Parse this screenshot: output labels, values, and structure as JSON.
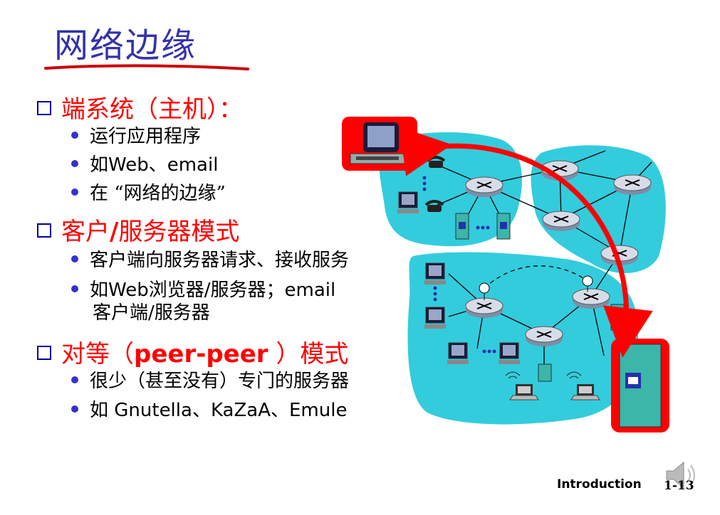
{
  "slide": {
    "title": "网络边缘",
    "sections": [
      {
        "heading_pre": "端系统（主机）：",
        "bullets": [
          {
            "pre": "运行应用程序"
          },
          {
            "pre": "如",
            "latin": "Web",
            "post": "、",
            "latin2": "email"
          },
          {
            "pre": "在 “网络的边缘”"
          }
        ]
      },
      {
        "heading_pre": "客户",
        "heading_latin": "/",
        "heading_post": "服务器模式",
        "bullets": [
          {
            "pre": "客户端向服务器请求、接收服务"
          },
          {
            "pre": "如",
            "latin": "Web",
            "post": "浏览器",
            "latin2": "/",
            "post2": "服务器；",
            "latin3": "email",
            "cont": "客户端/服务器"
          }
        ]
      },
      {
        "heading_pre": "对等（",
        "heading_latin": "peer-peer",
        "heading_post": " ）模式",
        "bullets": [
          {
            "pre": "很少（甚至没有）专门的服务器"
          },
          {
            "pre": "如 ",
            "latin": "Gnutella、KaZaA、Emule"
          }
        ]
      }
    ]
  },
  "footer": {
    "label": "Introduction",
    "page": "1-13"
  },
  "colors": {
    "title": "#3333aa",
    "heading": "#ff0000",
    "bullet_dot": "#3333cc",
    "network_cloud": "#33ccdd",
    "highlight": "#ff0000"
  },
  "icons": [
    "speaker-icon",
    "host-computer-icon",
    "server-icon",
    "router-icon",
    "phone-icon",
    "laptop-icon"
  ]
}
